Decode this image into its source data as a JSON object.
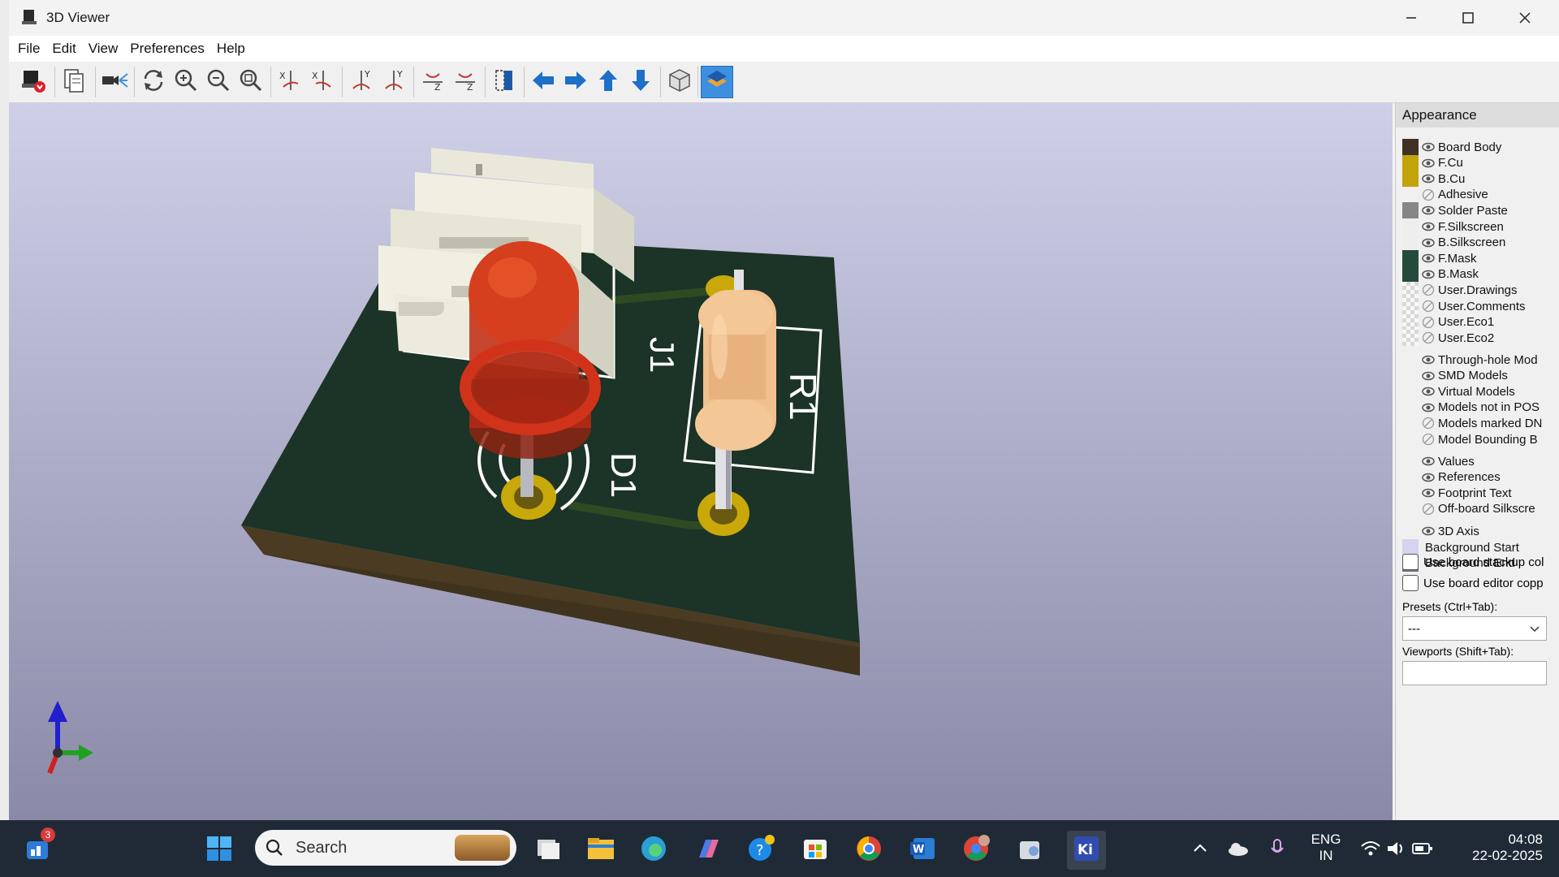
{
  "window": {
    "title": "3D Viewer"
  },
  "menu": [
    "File",
    "Edit",
    "View",
    "Preferences",
    "Help"
  ],
  "toolbar": {
    "icons": [
      "export-icon",
      "copy-icon",
      "raytrace-icon",
      "reload-icon",
      "zoom-in-icon",
      "zoom-out-icon",
      "zoom-fit-icon",
      "rotate-x-cw-icon",
      "rotate-x-ccw-icon",
      "rotate-y-cw-icon",
      "rotate-y-ccw-icon",
      "rotate-z-cw-icon",
      "rotate-z-ccw-icon",
      "flip-board-icon",
      "pan-left-icon",
      "pan-right-icon",
      "pan-up-icon",
      "pan-down-icon",
      "ortho-icon",
      "layers-toggle-icon"
    ],
    "active": "layers-toggle-icon"
  },
  "board": {
    "labels": {
      "j1": "J1",
      "d1": "D1",
      "r1": "R1"
    },
    "colors": {
      "pcb": "#1c3327",
      "edge": "#4a3b22",
      "copper": "#c9a80a",
      "silk": "#ffffff",
      "led": "#d0331a",
      "connector": "#efeee0",
      "resistor": "#f0c08e"
    }
  },
  "panel": {
    "title": "Appearance",
    "layers": [
      {
        "name": "Board Body",
        "swatch": "#3f3224",
        "vis": "eye"
      },
      {
        "name": "F.Cu",
        "swatch": "#c2a309",
        "vis": "eye"
      },
      {
        "name": "B.Cu",
        "swatch": "#c2a309",
        "vis": "eye"
      },
      {
        "name": "Adhesive",
        "swatch": "none",
        "vis": "off"
      },
      {
        "name": "Solder Paste",
        "swatch": "#868686",
        "vis": "eye"
      },
      {
        "name": "F.Silkscreen",
        "swatch": "#eeeeee",
        "vis": "eye"
      },
      {
        "name": "B.Silkscreen",
        "swatch": "#eeeeee",
        "vis": "eye"
      },
      {
        "name": "F.Mask",
        "swatch": "#254a3c",
        "vis": "eye"
      },
      {
        "name": "B.Mask",
        "swatch": "#254a3c",
        "vis": "eye"
      },
      {
        "name": "User.Drawings",
        "swatch": "check",
        "vis": "off"
      },
      {
        "name": "User.Comments",
        "swatch": "check",
        "vis": "off"
      },
      {
        "name": "User.Eco1",
        "swatch": "check",
        "vis": "off"
      },
      {
        "name": "User.Eco2",
        "swatch": "check",
        "vis": "off"
      }
    ],
    "models": [
      {
        "name": "Through-hole Mod",
        "vis": "eye"
      },
      {
        "name": "SMD Models",
        "vis": "eye"
      },
      {
        "name": "Virtual Models",
        "vis": "eye"
      },
      {
        "name": "Models not in POS",
        "vis": "eye"
      },
      {
        "name": "Models marked DN",
        "vis": "off"
      },
      {
        "name": "Model Bounding B",
        "vis": "off"
      }
    ],
    "texts": [
      {
        "name": "Values",
        "vis": "eye"
      },
      {
        "name": "References",
        "vis": "eye"
      },
      {
        "name": "Footprint Text",
        "vis": "eye"
      },
      {
        "name": "Off-board Silkscre",
        "vis": "off"
      }
    ],
    "axis": {
      "name": "3D Axis",
      "vis": "eye"
    },
    "backgrounds": [
      {
        "name": "Background Start",
        "swatch": "#d4d4ee"
      },
      {
        "name": "Background End",
        "swatch": "#6e6e86"
      }
    ],
    "checkboxes": [
      "Use board stackup col",
      "Use board editor copp"
    ],
    "presets_label": "Presets (Ctrl+Tab):",
    "presets_value": "---",
    "viewports_label": "Viewports (Shift+Tab):"
  },
  "taskbar": {
    "search_placeholder": "Search",
    "badge": "3",
    "lang1": "ENG",
    "lang2": "IN",
    "time": "04:08",
    "date": "22-02-2025"
  }
}
